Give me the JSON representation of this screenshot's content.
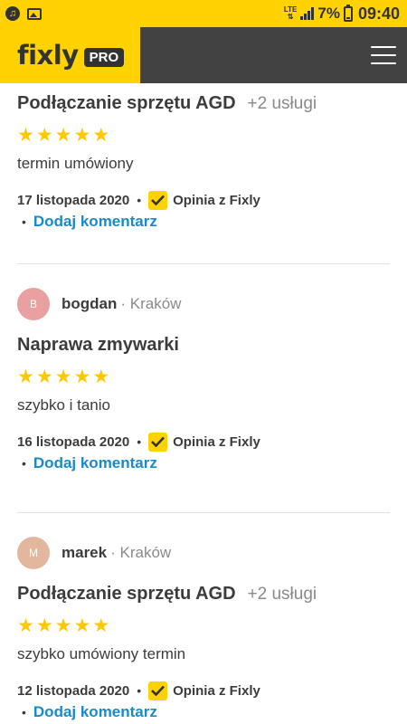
{
  "status_bar": {
    "network": "LTE",
    "battery": "7%",
    "time": "09:40"
  },
  "header": {
    "logo": "fixly",
    "badge": "PRO"
  },
  "reviews": [
    {
      "title": "Podłączanie sprzętu AGD",
      "extra": "+2 usługi",
      "rating": 5,
      "stars": "★★★★★",
      "text": "termin umówiony",
      "date": "17 listopada 2020",
      "source": "Opinia z Fixly",
      "comment_link": "Dodaj komentarz"
    },
    {
      "avatar_letter": "B",
      "avatar_color": "#e8a0a0",
      "user": "bogdan",
      "city": "· Kraków",
      "title": "Naprawa zmywarki",
      "rating": 5,
      "stars": "★★★★★",
      "text": "szybko i tanio",
      "date": "16 listopada 2020",
      "source": "Opinia z Fixly",
      "comment_link": "Dodaj komentarz"
    },
    {
      "avatar_letter": "M",
      "avatar_color": "#e3b79e",
      "user": "marek",
      "city": "· Kraków",
      "title": "Podłączanie sprzętu AGD",
      "extra": "+2 usługi",
      "rating": 5,
      "stars": "★★★★★",
      "text": "szybko umówiony termin",
      "date": "12 listopada 2020",
      "source": "Opinia z Fixly",
      "comment_link": "Dodaj komentarz"
    }
  ],
  "colors": {
    "brand_yellow": "#ffd200",
    "header_dark": "#424242",
    "link_blue": "#1b8ac6",
    "star_yellow": "#ffc800"
  }
}
